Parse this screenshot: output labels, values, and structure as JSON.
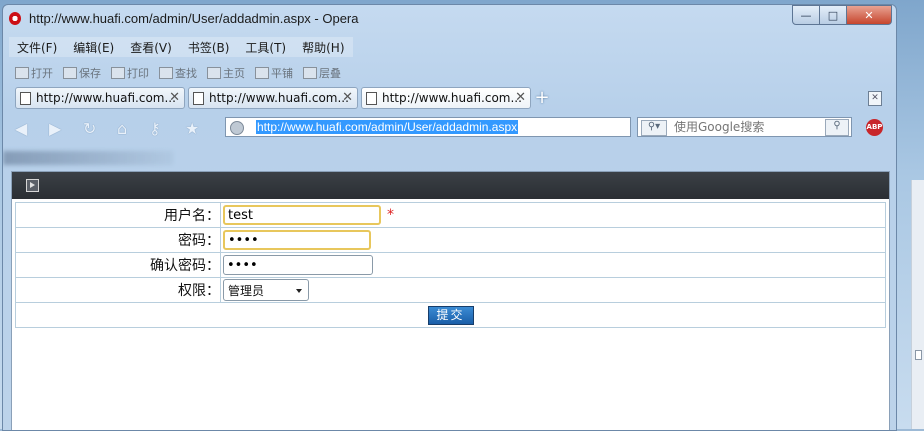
{
  "window": {
    "title": "http://www.huafi.com/admin/User/addadmin.aspx - Opera",
    "buttons": {
      "minimize": "—",
      "maximize": "□",
      "close": "✕"
    }
  },
  "menu": [
    "文件(F)",
    "编辑(E)",
    "查看(V)",
    "书签(B)",
    "工具(T)",
    "帮助(H)"
  ],
  "toolbar": [
    "打开",
    "保存",
    "打印",
    "查找",
    "主页",
    "平铺",
    "层叠"
  ],
  "tabs": [
    {
      "label": "http://www.huafi.com...",
      "active": false
    },
    {
      "label": "http://www.huafi.com...",
      "active": false
    },
    {
      "label": "http://www.huafi.com...",
      "active": true
    }
  ],
  "nav": {
    "url": "http://www.huafi.com/admin/User/addadmin.aspx",
    "search_placeholder": "使用Google搜索",
    "adblock_label": "ABP"
  },
  "form": {
    "username_label": "用户名：",
    "username_value": "test",
    "required_mark": "*",
    "password_label": "密码：",
    "password_value": "test",
    "confirm_label": "确认密码：",
    "confirm_value": "test",
    "role_label": "权限：",
    "role_value": "管理员",
    "submit_label": "提交"
  }
}
